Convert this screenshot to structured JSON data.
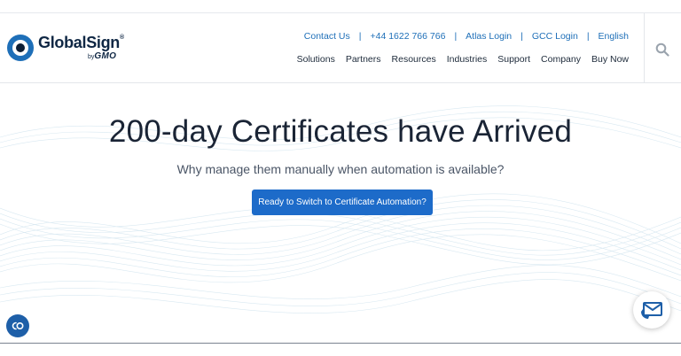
{
  "brand": {
    "name": "GlobalSign",
    "registered": "®",
    "by": "by",
    "parent": "GMO"
  },
  "utility_nav": [
    {
      "label": "Contact Us"
    },
    {
      "label": "+44 1622 766 766"
    },
    {
      "label": "Atlas Login"
    },
    {
      "label": "GCC Login"
    },
    {
      "label": "English"
    }
  ],
  "utility_separator": "|",
  "main_nav": [
    {
      "label": "Solutions"
    },
    {
      "label": "Partners"
    },
    {
      "label": "Resources"
    },
    {
      "label": "Industries"
    },
    {
      "label": "Support"
    },
    {
      "label": "Company"
    },
    {
      "label": "Buy Now"
    }
  ],
  "hero": {
    "title": "200-day Certificates have Arrived",
    "subtitle": "Why manage them manually when automation is available?",
    "cta_label": "Ready to Switch to Certificate Automation?"
  },
  "icons": {
    "search": "search-icon",
    "chat": "chat-icon",
    "contact": "envelope-phone-icon"
  },
  "colors": {
    "accent": "#1d6bc9",
    "link": "#1e6fb8",
    "brand_dark": "#0f2744",
    "chat_bg": "#1e5fa8"
  }
}
